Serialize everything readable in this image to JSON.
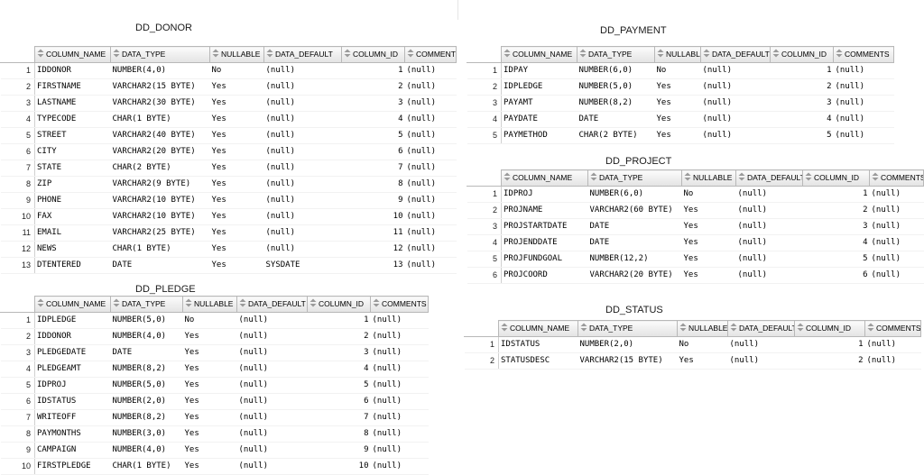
{
  "columns": [
    "COLUMN_NAME",
    "DATA_TYPE",
    "NULLABLE",
    "DATA_DEFAULT",
    "COLUMN_ID",
    "COMMENTS"
  ],
  "tables": {
    "donor": {
      "title": "DD_DONOR",
      "rows": [
        [
          "1",
          "IDDONOR",
          "NUMBER(4,0)",
          "No",
          "(null)",
          "1",
          "(null)"
        ],
        [
          "2",
          "FIRSTNAME",
          "VARCHAR2(15 BYTE)",
          "Yes",
          "(null)",
          "2",
          "(null)"
        ],
        [
          "3",
          "LASTNAME",
          "VARCHAR2(30 BYTE)",
          "Yes",
          "(null)",
          "3",
          "(null)"
        ],
        [
          "4",
          "TYPECODE",
          "CHAR(1 BYTE)",
          "Yes",
          "(null)",
          "4",
          "(null)"
        ],
        [
          "5",
          "STREET",
          "VARCHAR2(40 BYTE)",
          "Yes",
          "(null)",
          "5",
          "(null)"
        ],
        [
          "6",
          "CITY",
          "VARCHAR2(20 BYTE)",
          "Yes",
          "(null)",
          "6",
          "(null)"
        ],
        [
          "7",
          "STATE",
          "CHAR(2 BYTE)",
          "Yes",
          "(null)",
          "7",
          "(null)"
        ],
        [
          "8",
          "ZIP",
          "VARCHAR2(9 BYTE)",
          "Yes",
          "(null)",
          "8",
          "(null)"
        ],
        [
          "9",
          "PHONE",
          "VARCHAR2(10 BYTE)",
          "Yes",
          "(null)",
          "9",
          "(null)"
        ],
        [
          "10",
          "FAX",
          "VARCHAR2(10 BYTE)",
          "Yes",
          "(null)",
          "10",
          "(null)"
        ],
        [
          "11",
          "EMAIL",
          "VARCHAR2(25 BYTE)",
          "Yes",
          "(null)",
          "11",
          "(null)"
        ],
        [
          "12",
          "NEWS",
          "CHAR(1 BYTE)",
          "Yes",
          "(null)",
          "12",
          "(null)"
        ],
        [
          "13",
          "DTENTERED",
          "DATE",
          "Yes",
          "SYSDATE",
          "13",
          "(null)"
        ]
      ]
    },
    "payment": {
      "title": "DD_PAYMENT",
      "rows": [
        [
          "1",
          "IDPAY",
          "NUMBER(6,0)",
          "No",
          "(null)",
          "1",
          "(null)"
        ],
        [
          "2",
          "IDPLEDGE",
          "NUMBER(5,0)",
          "Yes",
          "(null)",
          "2",
          "(null)"
        ],
        [
          "3",
          "PAYAMT",
          "NUMBER(8,2)",
          "Yes",
          "(null)",
          "3",
          "(null)"
        ],
        [
          "4",
          "PAYDATE",
          "DATE",
          "Yes",
          "(null)",
          "4",
          "(null)"
        ],
        [
          "5",
          "PAYMETHOD",
          "CHAR(2 BYTE)",
          "Yes",
          "(null)",
          "5",
          "(null)"
        ]
      ]
    },
    "project": {
      "title": "DD_PROJECT",
      "rows": [
        [
          "1",
          "IDPROJ",
          "NUMBER(6,0)",
          "No",
          "(null)",
          "1",
          "(null)"
        ],
        [
          "2",
          "PROJNAME",
          "VARCHAR2(60 BYTE)",
          "Yes",
          "(null)",
          "2",
          "(null)"
        ],
        [
          "3",
          "PROJSTARTDATE",
          "DATE",
          "Yes",
          "(null)",
          "3",
          "(null)"
        ],
        [
          "4",
          "PROJENDDATE",
          "DATE",
          "Yes",
          "(null)",
          "4",
          "(null)"
        ],
        [
          "5",
          "PROJFUNDGOAL",
          "NUMBER(12,2)",
          "Yes",
          "(null)",
          "5",
          "(null)"
        ],
        [
          "6",
          "PROJCOORD",
          "VARCHAR2(20 BYTE)",
          "Yes",
          "(null)",
          "6",
          "(null)"
        ]
      ]
    },
    "pledge": {
      "title": "DD_PLEDGE",
      "rows": [
        [
          "1",
          "IDPLEDGE",
          "NUMBER(5,0)",
          "No",
          "(null)",
          "1",
          "(null)"
        ],
        [
          "2",
          "IDDONOR",
          "NUMBER(4,0)",
          "Yes",
          "(null)",
          "2",
          "(null)"
        ],
        [
          "3",
          "PLEDGEDATE",
          "DATE",
          "Yes",
          "(null)",
          "3",
          "(null)"
        ],
        [
          "4",
          "PLEDGEAMT",
          "NUMBER(8,2)",
          "Yes",
          "(null)",
          "4",
          "(null)"
        ],
        [
          "5",
          "IDPROJ",
          "NUMBER(5,0)",
          "Yes",
          "(null)",
          "5",
          "(null)"
        ],
        [
          "6",
          "IDSTATUS",
          "NUMBER(2,0)",
          "Yes",
          "(null)",
          "6",
          "(null)"
        ],
        [
          "7",
          "WRITEOFF",
          "NUMBER(8,2)",
          "Yes",
          "(null)",
          "7",
          "(null)"
        ],
        [
          "8",
          "PAYMONTHS",
          "NUMBER(3,0)",
          "Yes",
          "(null)",
          "8",
          "(null)"
        ],
        [
          "9",
          "CAMPAIGN",
          "NUMBER(4,0)",
          "Yes",
          "(null)",
          "9",
          "(null)"
        ],
        [
          "10",
          "FIRSTPLEDGE",
          "CHAR(1 BYTE)",
          "Yes",
          "(null)",
          "10",
          "(null)"
        ]
      ]
    },
    "status": {
      "title": "DD_STATUS",
      "rows": [
        [
          "1",
          "IDSTATUS",
          "NUMBER(2,0)",
          "No",
          "(null)",
          "1",
          "(null)"
        ],
        [
          "2",
          "STATUSDESC",
          "VARCHAR2(15 BYTE)",
          "Yes",
          "(null)",
          "2",
          "(null)"
        ]
      ]
    }
  }
}
